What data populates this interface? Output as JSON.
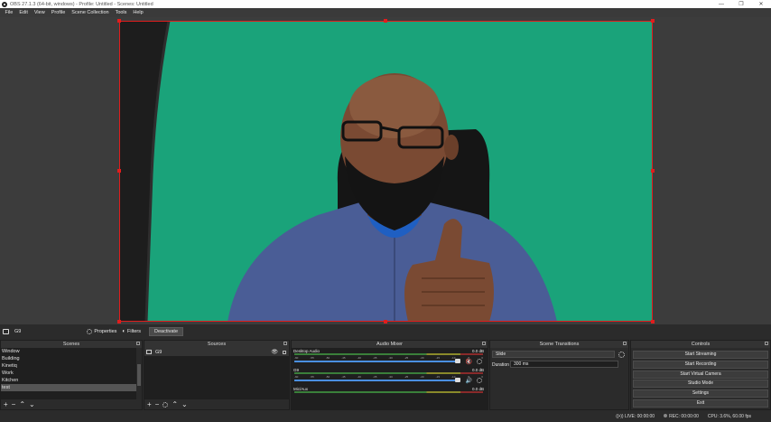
{
  "window": {
    "title": "OBS 27.1.3 (64-bit, windows) - Profile: Untitled - Scenes: Untitled",
    "controls": [
      "—",
      "❐",
      "✕"
    ]
  },
  "menu": [
    "File",
    "Edit",
    "View",
    "Profile",
    "Scene Collection",
    "Tools",
    "Help"
  ],
  "source_toolbar": {
    "source_name": "G9",
    "properties_label": "Properties",
    "filters_label": "Filters",
    "deactivate_label": "Deactivate"
  },
  "scenes": {
    "title": "Scenes",
    "items": [
      "Window",
      "Building",
      "Kinetiq",
      "Work",
      "Kitchen",
      "test"
    ],
    "selected_index": 5
  },
  "sources": {
    "title": "Sources",
    "items": [
      "G9"
    ]
  },
  "audio_mixer": {
    "title": "Audio Mixer",
    "channels": [
      {
        "name": "Desktop Audio",
        "db": "0.0 dB",
        "muted": true
      },
      {
        "name": "G9",
        "db": "0.0 dB",
        "muted": false
      },
      {
        "name": "Mic/Aux",
        "db": "0.0 dB",
        "muted": false
      }
    ],
    "ticks": [
      "-60",
      "-55",
      "-50",
      "-45",
      "-40",
      "-35",
      "-30",
      "-25",
      "-20",
      "-15",
      "-10",
      "-5",
      "0"
    ]
  },
  "transitions": {
    "title": "Scene Transitions",
    "selected": "Slide",
    "duration_label": "Duration",
    "duration_value": "300 ms"
  },
  "controls": {
    "title": "Controls",
    "buttons": [
      "Start Streaming",
      "Start Recording",
      "Start Virtual Camera",
      "Studio Mode",
      "Settings",
      "Exit"
    ]
  },
  "status": {
    "live": "LIVE: 00:00:00",
    "rec": "REC: 00:00:00",
    "cpu": "CPU: 3.6%, 60.00 fps"
  },
  "colors": {
    "selection": "#e01d1d",
    "green_screen": "#1aa37a",
    "fader": "#4a8fe0"
  }
}
